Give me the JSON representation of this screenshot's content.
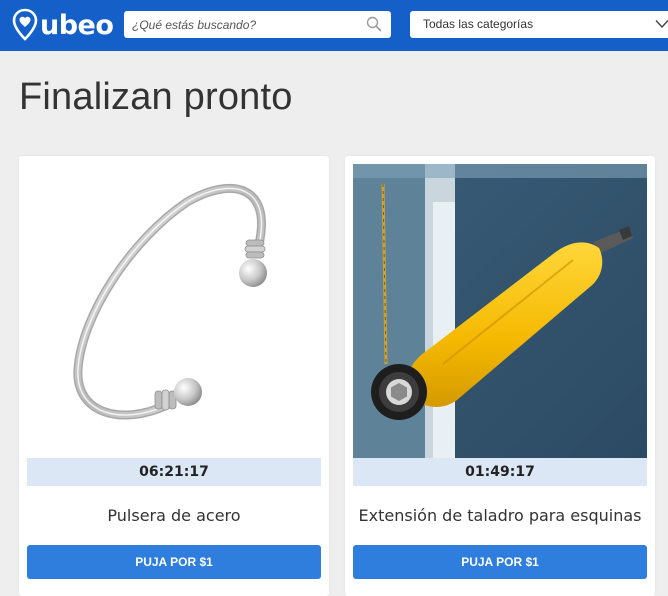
{
  "header": {
    "logo_text": "ubeo",
    "search": {
      "placeholder": "¿Qué estás buscando?",
      "icon": "search-icon"
    },
    "category_select": {
      "selected": "Todas las categorías",
      "icon": "chevron-down-icon"
    }
  },
  "main": {
    "title": "Finalizan pronto",
    "products": [
      {
        "name": "Pulsera de acero",
        "timer": "06:21:17",
        "bid_label": "PUJA POR $1"
      },
      {
        "name": "Extensión de taladro para esquinas",
        "timer": "01:49:17",
        "bid_label": "PUJA POR $1"
      }
    ]
  },
  "colors": {
    "brand": "#1460c8",
    "button": "#2f7ddd",
    "timer_bg": "#dce7f6",
    "page_bg": "#eeeeee"
  }
}
